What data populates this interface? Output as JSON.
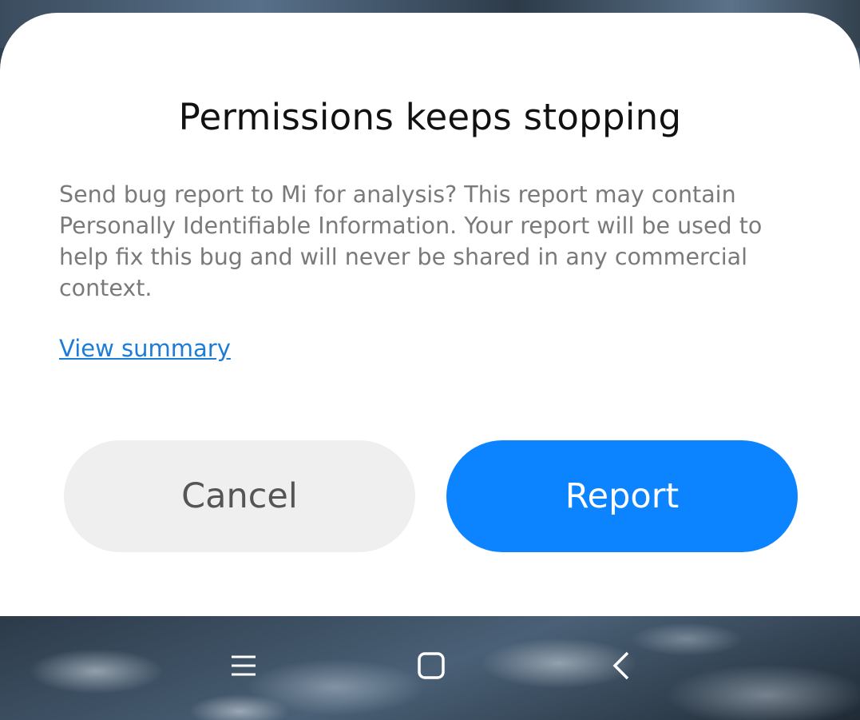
{
  "dialog": {
    "title": "Permissions keeps stopping",
    "message": "Send bug report to Mi for analysis? This report may contain Personally Identifiable Information. Your report will be used to help fix this bug and will never be shared in any commercial context.",
    "summary_link": "View summary",
    "cancel_label": "Cancel",
    "report_label": "Report"
  },
  "navbar": {
    "icons": [
      "menu-icon",
      "home-icon",
      "back-icon"
    ]
  },
  "colors": {
    "accent": "#0d84ff",
    "link": "#1c7cd6",
    "cancel_bg": "#efefef",
    "message_text": "#7a7a7a"
  }
}
